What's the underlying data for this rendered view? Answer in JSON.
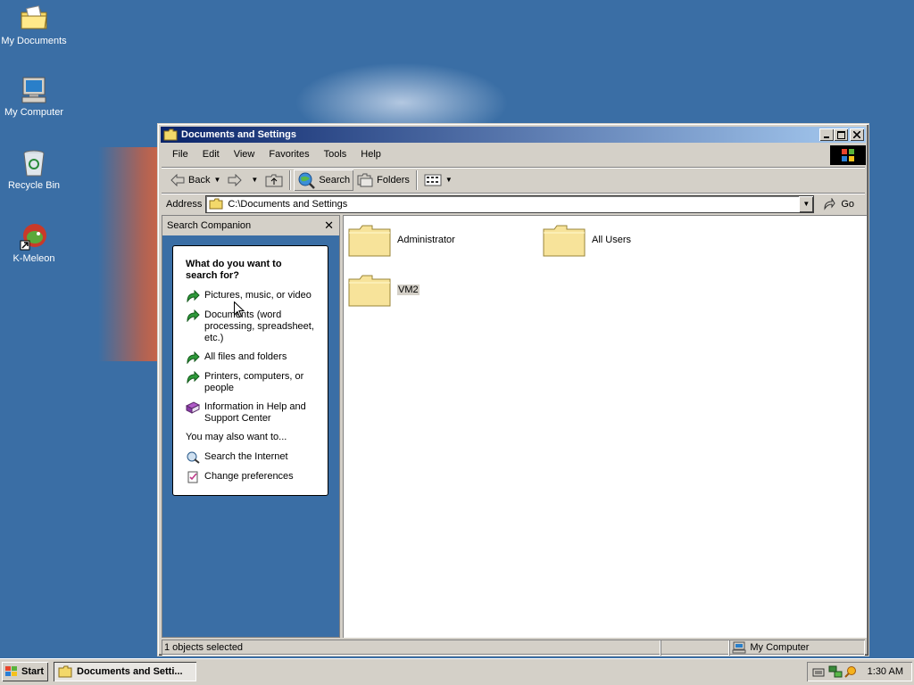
{
  "desktop": {
    "icons": [
      {
        "label": "My Documents"
      },
      {
        "label": "My Computer"
      },
      {
        "label": "Recycle Bin"
      },
      {
        "label": "K-Meleon"
      }
    ]
  },
  "window": {
    "title": "Documents and Settings",
    "menu": [
      "File",
      "Edit",
      "View",
      "Favorites",
      "Tools",
      "Help"
    ],
    "toolbar": {
      "back_label": "Back",
      "search_label": "Search",
      "folders_label": "Folders"
    },
    "address": {
      "label": "Address",
      "value": "C:\\Documents and Settings",
      "go_label": "Go"
    },
    "search_companion": {
      "title": "Search Companion",
      "question": "What do you want to search for?",
      "options": [
        "Pictures, music, or video",
        "Documents (word processing, spreadsheet, etc.)",
        "All files and folders",
        "Printers, computers, or people",
        "Information in Help and Support Center"
      ],
      "also_label": "You may also want to...",
      "also_options": [
        "Search the Internet",
        "Change preferences"
      ]
    },
    "folders": [
      {
        "name": "Administrator"
      },
      {
        "name": "All Users"
      },
      {
        "name": "VM2"
      }
    ],
    "status": {
      "selected": "1 objects selected",
      "location": "My Computer"
    }
  },
  "taskbar": {
    "start_label": "Start",
    "task_label": "Documents and Setti...",
    "clock": "1:30 AM"
  },
  "colors": {
    "desktop": "#3a6ea5",
    "titlebar_start": "#0a246a",
    "titlebar_end": "#a6caf0",
    "chrome": "#d4d0c8",
    "folder": "#fff3a8"
  }
}
